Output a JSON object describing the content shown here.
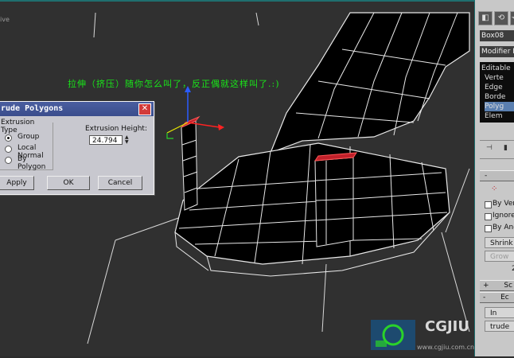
{
  "viewport": {
    "label": "ive"
  },
  "annotation": "拉伸（挤压）随你怎么叫了，反正偶就这样叫了.:)",
  "dialog": {
    "title": "rude Polygons",
    "close_glyph": "✕",
    "extrusion_type_label": "Extrusion Type",
    "options": [
      "Group",
      "Local Normal",
      "By Polygon"
    ],
    "selected_option": "Group",
    "height_label": "Extrusion Height:",
    "height_value": "24.794",
    "buttons": {
      "apply": "Apply",
      "ok": "OK",
      "cancel": "Cancel"
    }
  },
  "panel": {
    "object_name": "Box08",
    "modifier_list": "Modifier List",
    "stack": [
      "Editable",
      "Verte",
      "Edge",
      "Borde",
      "Polyg",
      "Elem"
    ],
    "selected_stack": "Polyg",
    "checkboxes": [
      "By Vert",
      "Ignore",
      "By Ang"
    ],
    "shrink": "Shrink",
    "grow": "Grow",
    "number": "2",
    "rollouts": [
      {
        "sign": "+",
        "label": "Sc"
      },
      {
        "sign": "-",
        "label": "Ec"
      }
    ],
    "insert": "In",
    "extrude": "trude"
  },
  "watermark": {
    "text": "CGJIU",
    "url": "www.cgjiu.com.cn"
  },
  "colors": {
    "annotation": "#19e619",
    "selection": "#5a7fb0",
    "highlight_face": "#c0202a"
  }
}
